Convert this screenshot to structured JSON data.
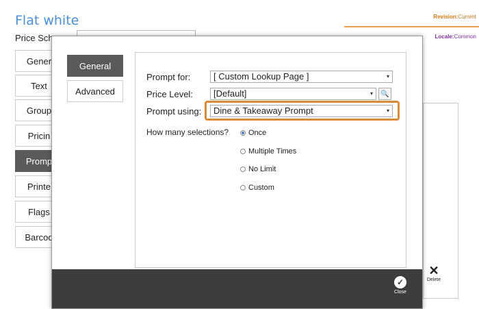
{
  "background": {
    "title": "Flat white",
    "revision_label": "Revision:",
    "revision_value": "Current",
    "locale_label": "Locale:",
    "locale_value": "Common",
    "price_schedule_label": "Price Sch",
    "side_items": [
      "Gener",
      "Text",
      "Group",
      "Pricin",
      "Promp",
      "Printe",
      "Flags",
      "Barcod"
    ],
    "delete_label": "Delete"
  },
  "modal": {
    "tabs": [
      {
        "label": "General",
        "active": true
      },
      {
        "label": "Advanced",
        "active": false
      }
    ],
    "prompt_for_label": "Prompt for:",
    "prompt_for_value": "[ Custom Lookup Page ]",
    "price_level_label": "Price Level:",
    "price_level_value": "[Default]",
    "prompt_using_label": "Prompt using:",
    "prompt_using_value": "Dine & Takeaway Prompt",
    "selections_label": "How many selections?",
    "selection_options": [
      {
        "label": "Once",
        "checked": true
      },
      {
        "label": "Multiple Times",
        "checked": false
      },
      {
        "label": "No Limit",
        "checked": false
      },
      {
        "label": "Custom",
        "checked": false
      }
    ],
    "close_label": "Close"
  },
  "colors": {
    "accent_orange": "#d98b3a",
    "active_tab": "#5a5a5a",
    "footer": "#3d3d3d",
    "title_blue": "#4a90d9"
  }
}
